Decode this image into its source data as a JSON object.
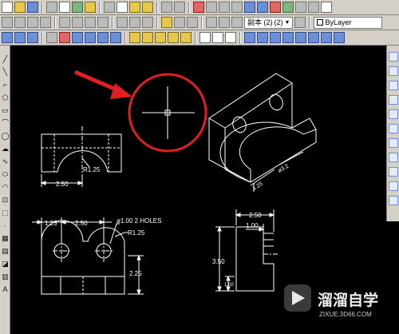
{
  "toolbar": {
    "dimstyle_value": "副本 (2)",
    "dimstyle_value2": "(2)",
    "layer_value": "ByLayer"
  },
  "drawing": {
    "front_view": {
      "dim_width": "2.50",
      "radius": "R1.25"
    },
    "plan_view": {
      "dim_left": "1.25",
      "dim_mid": "2.50",
      "holes_note": "ø1.00 2 HOLES",
      "radius": "R1.25",
      "dim_height": "2.25"
    },
    "side_view": {
      "dim_top": "2.50",
      "dim_inner": "1.00",
      "dim_height": "3.50",
      "dim_base": "1.00"
    },
    "iso_view": {
      "dim_a": "1.25",
      "dim_b": "ø3.2"
    }
  },
  "watermark": {
    "brand": "溜溜自学",
    "url": "ZIXUE.3D66.COM"
  },
  "colors": {
    "background": "#000000",
    "lines": "#ffffff",
    "highlight_circle": "#e02020",
    "arrow": "#e02020",
    "toolbar": "#d4d0c8"
  }
}
